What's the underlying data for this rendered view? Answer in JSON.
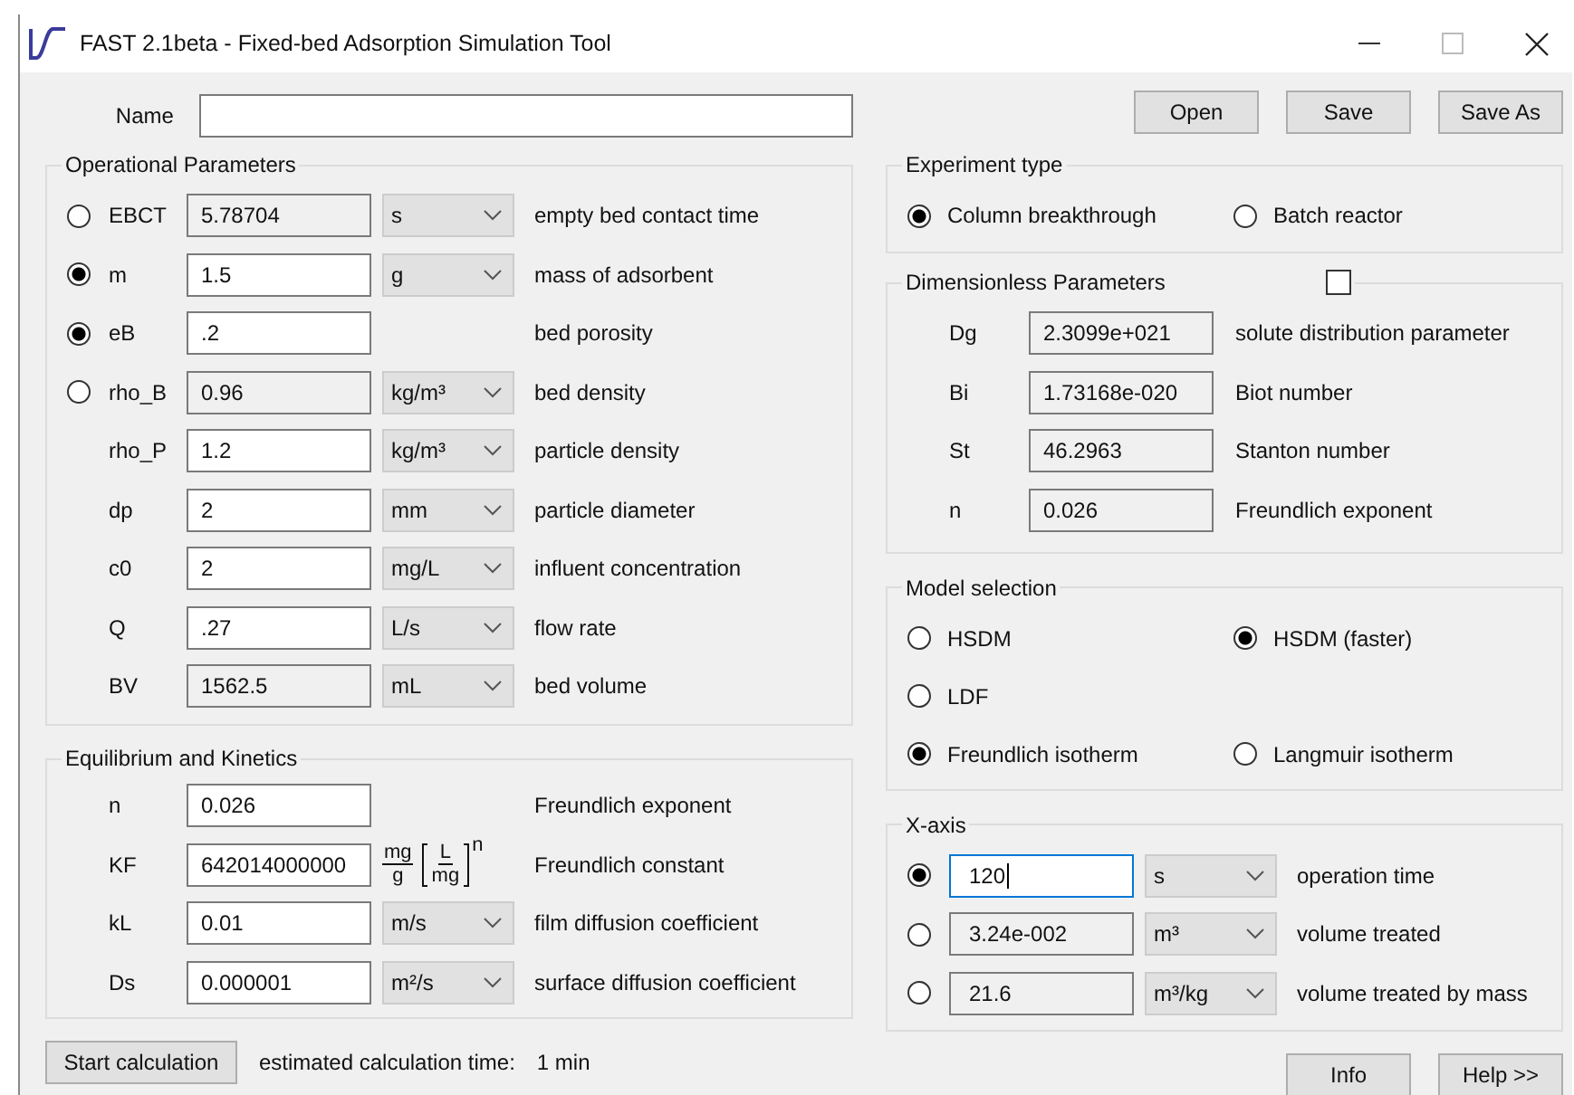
{
  "window": {
    "title": "FAST 2.1beta - Fixed-bed Adsorption Simulation Tool"
  },
  "name_field": {
    "label": "Name"
  },
  "file_buttons": [
    "Open",
    "Save",
    "Save As"
  ],
  "operational_parameters": {
    "title": "Operational Parameters",
    "rows": [
      {
        "kind": "radio",
        "selected": false,
        "symbol": "EBCT",
        "value": "5.78704",
        "editable": false,
        "unit": "s",
        "description": "empty bed contact time"
      },
      {
        "kind": "radio",
        "selected": true,
        "symbol": "m",
        "value": "1.5",
        "editable": true,
        "unit": "g",
        "description": "mass of adsorbent"
      },
      {
        "kind": "radio",
        "selected": true,
        "symbol": "eB",
        "value": ".2",
        "editable": true,
        "description": "bed porosity"
      },
      {
        "kind": "radio",
        "selected": false,
        "symbol": "rho_B",
        "value": "0.96",
        "editable": false,
        "unit": "kg/m³",
        "description": "bed density"
      },
      {
        "kind": "plain",
        "symbol": "rho_P",
        "value": "1.2",
        "editable": true,
        "unit": "kg/m³",
        "description": "particle density"
      },
      {
        "kind": "plain",
        "symbol": "dp",
        "value": "2",
        "editable": true,
        "unit": "mm",
        "description": "particle diameter"
      },
      {
        "kind": "plain",
        "symbol": "c0",
        "value": "2",
        "editable": true,
        "unit": "mg/L",
        "description": "influent concentration"
      },
      {
        "kind": "plain",
        "symbol": "Q",
        "value": ".27",
        "editable": true,
        "unit": "L/s",
        "description": "flow rate"
      },
      {
        "kind": "plain",
        "symbol": "BV",
        "value": "1562.5",
        "editable": false,
        "unit": "mL",
        "description": "bed volume"
      }
    ]
  },
  "equilibrium_kinetics": {
    "title": "Equilibrium and Kinetics",
    "rows": [
      {
        "symbol": "n",
        "value": "0.026",
        "description": "Freundlich exponent"
      },
      {
        "symbol": "KF",
        "value": "642014000000",
        "unit_formula": {
          "numerator": "mg",
          "denominator": "g",
          "inner_numerator": "L",
          "inner_denominator": "mg",
          "exponent": "n"
        },
        "description": "Freundlich constant"
      },
      {
        "symbol": "kL",
        "value": "0.01",
        "unit": "m/s",
        "description": "film diffusion coefficient"
      },
      {
        "symbol": "Ds",
        "value": "0.000001",
        "unit": "m²/s",
        "description": "surface diffusion coefficient"
      }
    ]
  },
  "calculation": {
    "button": "Start calculation",
    "estimate_label": "estimated calculation time:",
    "estimate_value": "1 min"
  },
  "experiment_type": {
    "title": "Experiment type",
    "options": [
      {
        "label": "Column breakthrough",
        "selected": true
      },
      {
        "label": "Batch reactor",
        "selected": false
      }
    ]
  },
  "dimensionless_parameters": {
    "title": "Dimensionless Parameters",
    "checked": false,
    "rows": [
      {
        "symbol": "Dg",
        "value": "2.3099e+021",
        "description": "solute distribution parameter"
      },
      {
        "symbol": "Bi",
        "value": "1.73168e-020",
        "description": "Biot number"
      },
      {
        "symbol": "St",
        "value": "46.2963",
        "description": "Stanton number"
      },
      {
        "symbol": "n",
        "value": "0.026",
        "description": "Freundlich exponent"
      }
    ]
  },
  "model_selection": {
    "title": "Model selection",
    "rows": [
      {
        "options": [
          {
            "label": "HSDM",
            "selected": false
          },
          {
            "label": "HSDM (faster)",
            "selected": true
          }
        ]
      },
      {
        "options": [
          {
            "label": "LDF",
            "selected": false
          }
        ]
      },
      {
        "options": [
          {
            "label": "Freundlich isotherm",
            "selected": true
          },
          {
            "label": "Langmuir isotherm",
            "selected": false
          }
        ]
      }
    ]
  },
  "x_axis": {
    "title": "X-axis",
    "rows": [
      {
        "selected": true,
        "value": "120",
        "editable": true,
        "focused": true,
        "unit": "s",
        "description": "operation time"
      },
      {
        "selected": false,
        "value": "3.24e-002",
        "editable": false,
        "focused": false,
        "unit": "m³",
        "description": "volume treated"
      },
      {
        "selected": false,
        "value": "21.6",
        "editable": false,
        "focused": false,
        "unit": "m³/kg",
        "description": "volume treated by mass"
      }
    ]
  },
  "bottom_buttons": [
    "Info",
    "Help >>"
  ]
}
